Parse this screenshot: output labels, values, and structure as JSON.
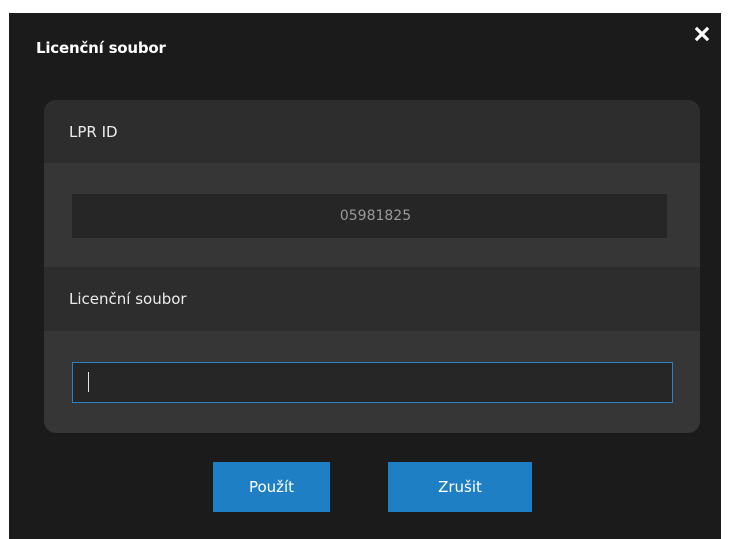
{
  "dialog": {
    "title": "Licenční soubor",
    "close_icon": "close-icon"
  },
  "lpr": {
    "label": "LPR ID",
    "value": "05981825"
  },
  "license": {
    "label": "Licenční soubor",
    "value": "",
    "placeholder": ""
  },
  "buttons": {
    "apply_label": "Použít",
    "cancel_label": "Zrušit"
  },
  "colors": {
    "accent": "#1f7fc4",
    "focus_border": "#2a82c9",
    "dialog_bg": "#1b1b1b",
    "panel_bg": "#363636"
  }
}
